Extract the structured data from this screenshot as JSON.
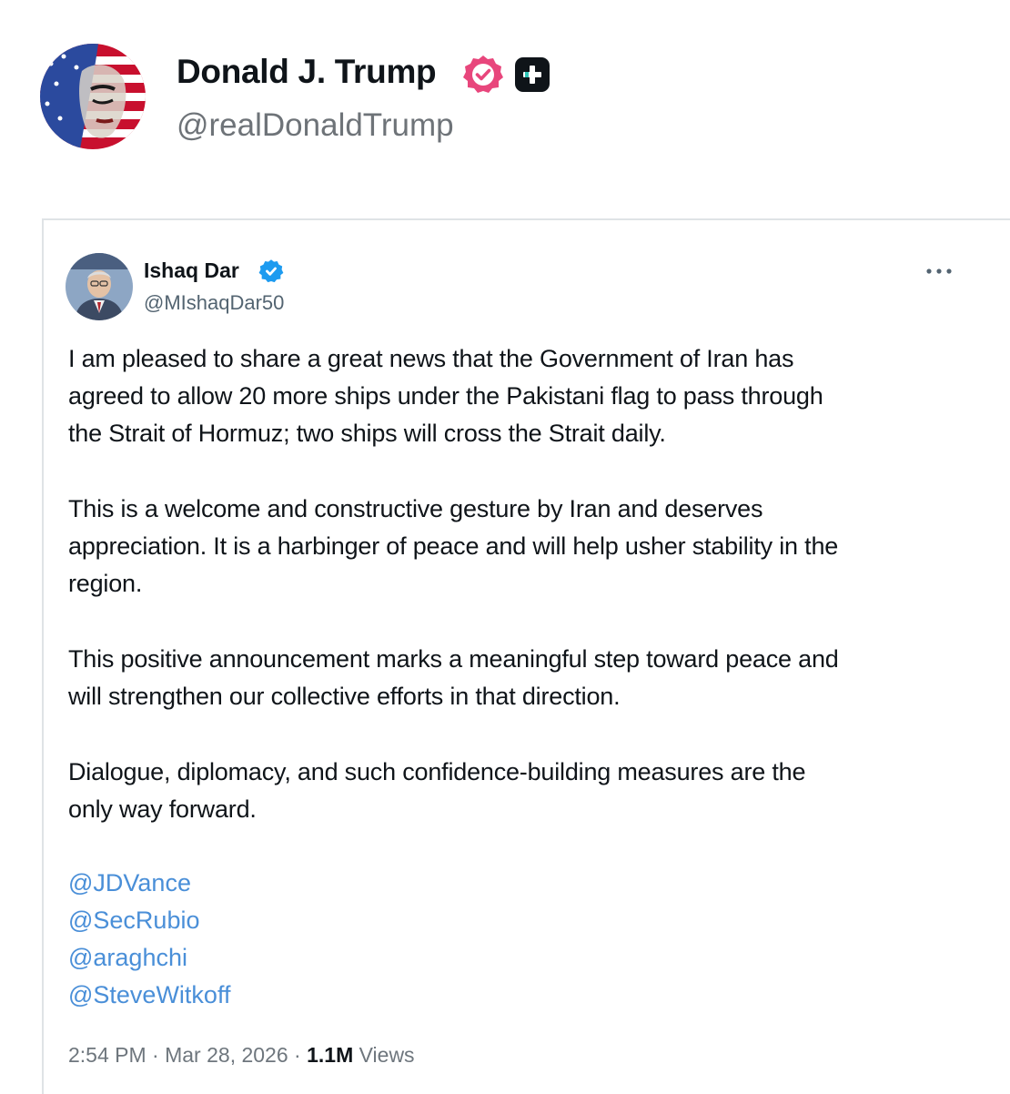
{
  "post": {
    "author_name": "Donald J. Trump",
    "author_handle": "@realDonaldTrump"
  },
  "quote": {
    "author_name": "Ishaq Dar",
    "author_handle": "@MIshaqDar50",
    "paragraphs": [
      "I am pleased to share a great news that the Government of Iran has\nagreed to allow 20 more ships under the Pakistani flag to pass through\nthe Strait of Hormuz; two ships will cross the Strait daily.",
      "This is a welcome and constructive gesture by Iran and deserves\nappreciation. It is a harbinger of peace and will help usher stability in the\nregion.",
      "This positive announcement marks a meaningful step toward peace and\nwill strengthen our collective efforts in that direction.",
      "Dialogue, diplomacy, and such confidence-building measures are the\nonly way forward."
    ],
    "mentions": [
      "@JDVance",
      "@SecRubio",
      "@araghchi",
      "@SteveWitkoff"
    ],
    "time": "2:54 PM",
    "date": "Mar 28, 2026",
    "separator": "·",
    "views_count": "1.1M",
    "views_label": "Views"
  },
  "icons": {
    "verified_badge": "verified-badge-icon",
    "plus_badge": "plus-badge-icon",
    "more": "more-options-icon"
  },
  "colors": {
    "verified_pink": "#e8467c",
    "verified_blue": "#1d9bf0",
    "mention_blue": "#4a8fd8",
    "meta_gray": "#6e767d"
  }
}
